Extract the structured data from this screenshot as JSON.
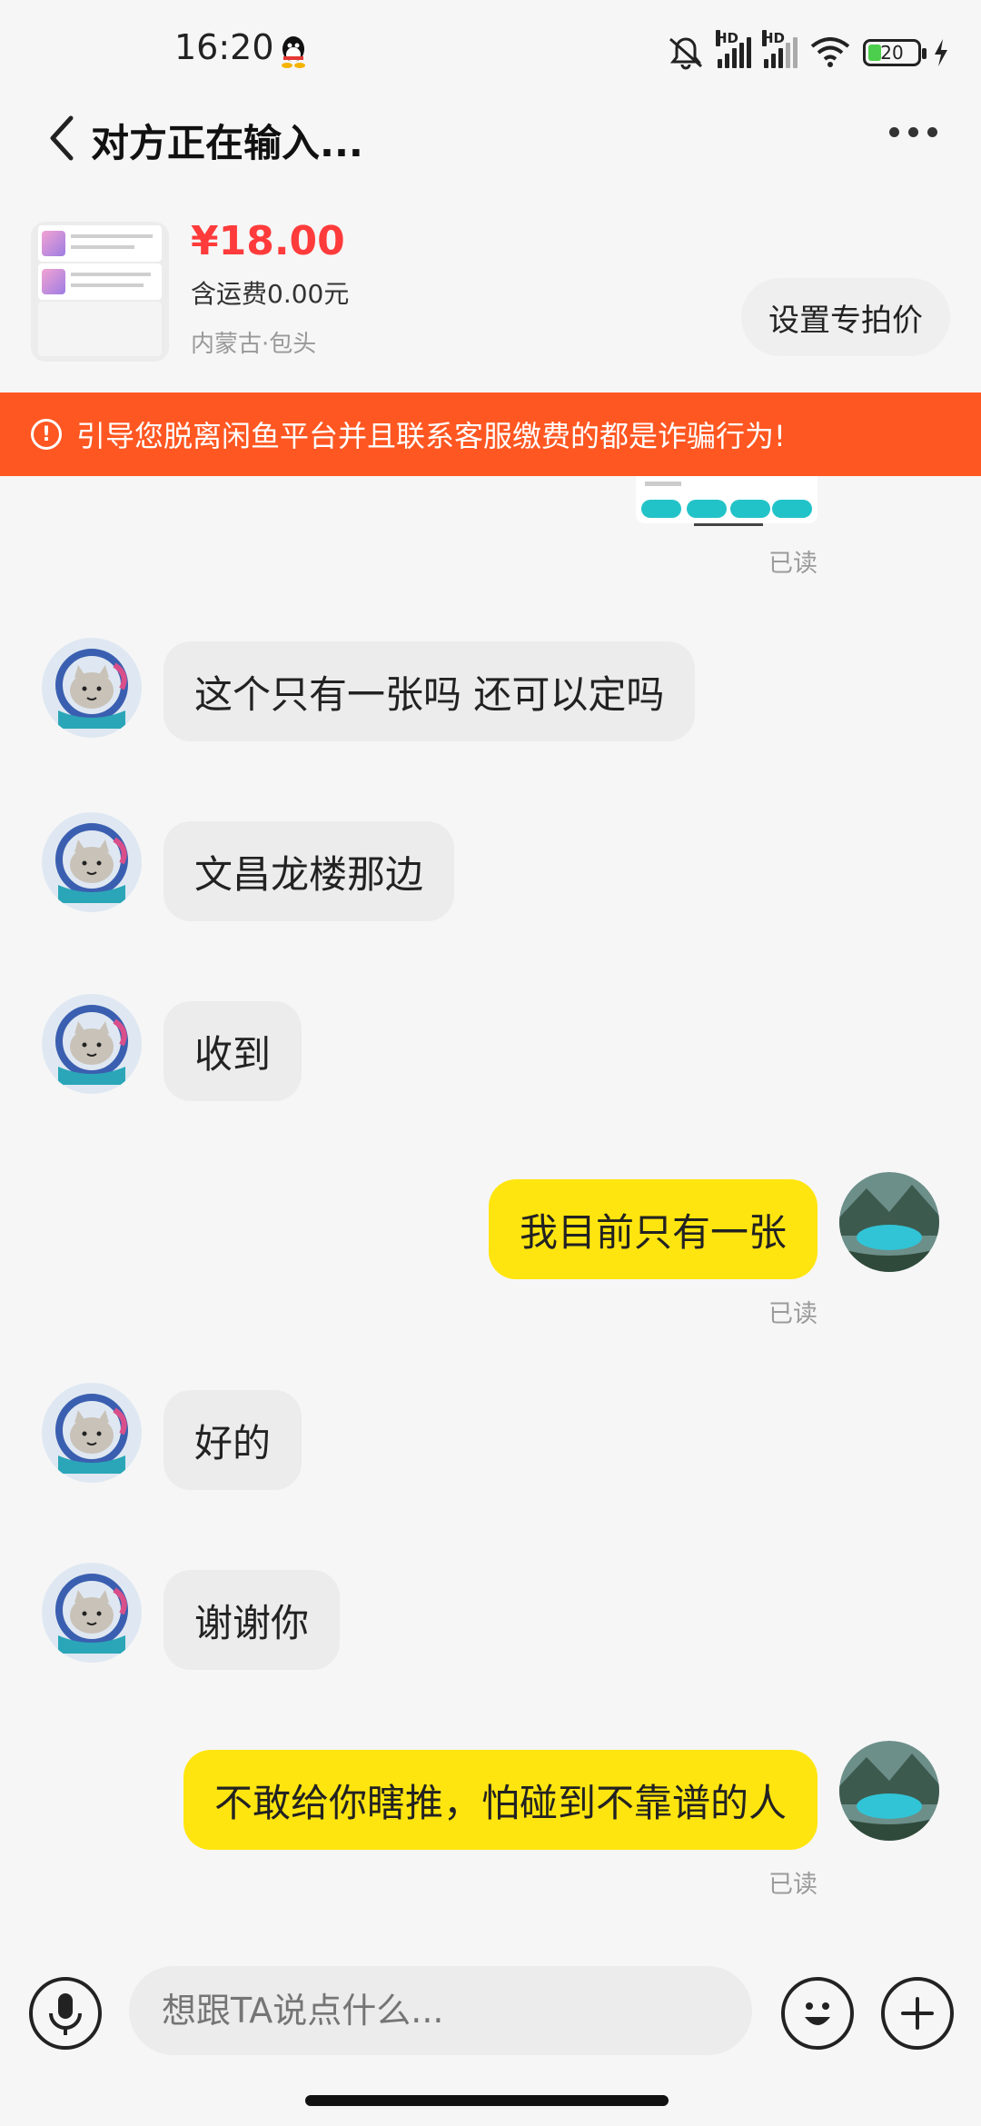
{
  "status_bar": {
    "time": "16:20",
    "battery_level": "20",
    "network_label": "HD",
    "icons": [
      "qq-icon",
      "mute-icon",
      "signal-icon",
      "wifi-icon",
      "battery-icon",
      "charging-icon"
    ]
  },
  "header": {
    "title": "对方正在输入..."
  },
  "product": {
    "price": "¥18.00",
    "shipping": "含运费0.00元",
    "location": "内蒙古·包头",
    "set_price_label": "设置专拍价"
  },
  "warning": {
    "text": "引导您脱离闲鱼平台并且联系客服缴费的都是诈骗行为!",
    "color": "#ff5722"
  },
  "messages": [
    {
      "side": "out",
      "type": "image",
      "read": "已读"
    },
    {
      "side": "in",
      "text": "这个只有一张吗  还可以定吗"
    },
    {
      "side": "in",
      "text": "文昌龙楼那边"
    },
    {
      "side": "in",
      "text": "收到"
    },
    {
      "side": "out",
      "text": "我目前只有一张",
      "read": "已读"
    },
    {
      "side": "in",
      "text": "好的"
    },
    {
      "side": "in",
      "text": "谢谢你"
    },
    {
      "side": "out",
      "text": "不敢给你瞎推，怕碰到不靠谱的人",
      "read": "已读"
    }
  ],
  "input": {
    "placeholder": "想跟TA说点什么..."
  },
  "colors": {
    "outgoing_bubble": "#ffe50f",
    "incoming_bubble": "#ececec",
    "price": "#ff3b3b"
  }
}
